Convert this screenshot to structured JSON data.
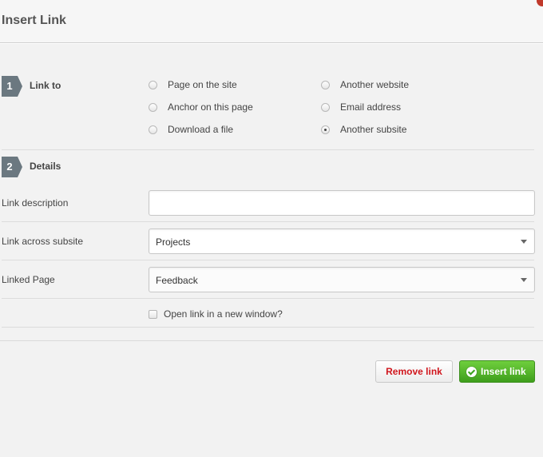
{
  "dialog": {
    "title": "Insert Link"
  },
  "step1": {
    "number": "1",
    "label": "Link to",
    "options": [
      {
        "label": "Page on the site",
        "checked": false
      },
      {
        "label": "Anchor on this page",
        "checked": false
      },
      {
        "label": "Download a file",
        "checked": false
      },
      {
        "label": "Another website",
        "checked": false
      },
      {
        "label": "Email address",
        "checked": false
      },
      {
        "label": "Another subsite",
        "checked": true
      }
    ]
  },
  "step2": {
    "number": "2",
    "label": "Details",
    "link_description": {
      "label": "Link description",
      "value": ""
    },
    "link_across_subsite": {
      "label": "Link across subsite",
      "value": "Projects"
    },
    "linked_page": {
      "label": "Linked Page",
      "value": "Feedback"
    },
    "new_window": {
      "label": "Open link in a new window?",
      "checked": false
    }
  },
  "buttons": {
    "remove_label": "Remove link",
    "insert_label": "Insert link"
  },
  "colors": {
    "step_badge": "#6b7880",
    "remove_text": "#d0161d",
    "insert_bg": "#4caf2a"
  }
}
